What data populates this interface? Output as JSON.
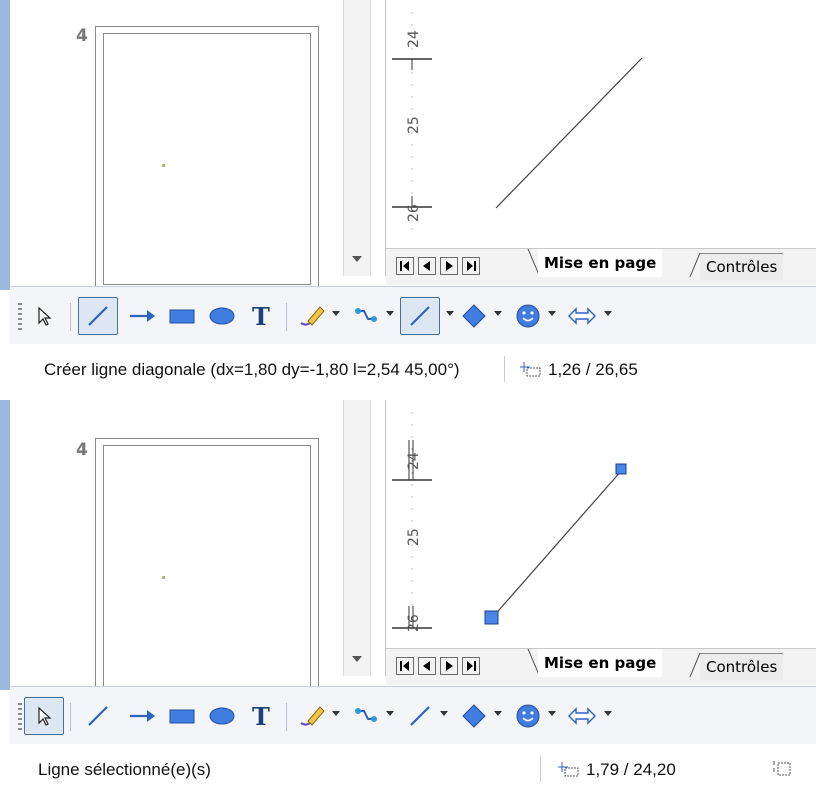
{
  "top": {
    "slide_number": "4",
    "ruler_labels": [
      "24",
      "25",
      "26"
    ],
    "tabs": [
      "Mise en page",
      "Contrôles"
    ],
    "status_message": "Créer ligne diagonale (dx=1,80 dy=-1,80  l=2,54 45,00°)",
    "position": "1,26 / 26,65",
    "active_tool": "line"
  },
  "bottom": {
    "slide_number": "4",
    "ruler_labels": [
      "24",
      "25",
      "26"
    ],
    "tabs": [
      "Mise en page",
      "Contrôles"
    ],
    "status_message": "Ligne sélectionné(e)(s)",
    "position": "1,79 / 24,20",
    "active_tool": "select"
  },
  "icons": [
    "select-arrow-icon",
    "line-icon",
    "arrow-line-icon",
    "rectangle-icon",
    "ellipse-icon",
    "text-icon",
    "freehand-pencil-icon",
    "connector-icon",
    "lines-arrows-icon",
    "basic-shapes-icon",
    "smiley-symbol-icon",
    "block-arrows-icon"
  ],
  "colors": {
    "accent": "#9cb9dd",
    "pressed_border": "#4a6f9c",
    "handle_fill": "#4a86e8"
  }
}
